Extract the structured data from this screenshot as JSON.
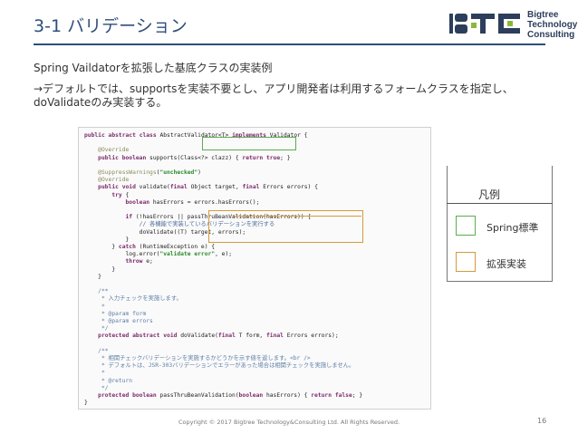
{
  "slide": {
    "title": "3-1 バリデーション",
    "subtitle": "Spring Vaildatorを拡張した基底クラスの実装例",
    "description": "→デフォルトでは、supportsを実装不要とし、アプリ開発者は利用するフォームクラスを指定し、doValidateのみ実装する。"
  },
  "logo": {
    "line1": "Bigtree",
    "line2": "Technology",
    "line3": "Consulting"
  },
  "code": {
    "lines": [
      "public abstract class AbstractValidator<T> implements Validator {",
      "",
      "    @Override",
      "    public boolean supports(Class<?> clazz) { return true; }",
      "",
      "    @SuppressWarnings(\"unchecked\")",
      "    @Override",
      "    public void validate(final Object target, final Errors errors) {",
      "        try {",
      "            boolean hasErrors = errors.hasErrors();",
      "",
      "            if (!hasErrors || passThruBeanValidation(hasErrors)) {",
      "                // 各機能で実装しているバリデーションを実行する",
      "                doValidate((T) target, errors);",
      "            }",
      "        } catch (RuntimeException e) {",
      "            log.error(\"validate error\", e);",
      "            throw e;",
      "        }",
      "    }",
      "",
      "    /**",
      "     * 入力チェックを実施します。",
      "     *",
      "     * @param form",
      "     * @param errors",
      "     */",
      "    protected abstract void doValidate(final T form, final Errors errors);",
      "",
      "    /**",
      "     * 相関チェックバリデーションを実施するかどうかを示す値を返します。<br />",
      "     * デフォルトは、JSR-303バリデーションでエラーがあった場合は相関チェックを実施しません。",
      "     *",
      "     * @return",
      "     */",
      "    protected boolean passThruBeanValidation(boolean hasErrors) { return false; }",
      "}"
    ]
  },
  "legend": {
    "title": "凡例",
    "items": [
      {
        "label": "Spring標準",
        "color": "#5cad50"
      },
      {
        "label": "拡張実装",
        "color": "#d49a3a"
      }
    ]
  },
  "footer": {
    "copyright": "Copyright © 2017 Bigtree Technology&Consulting Ltd. All Rights Reserved.",
    "page": "16"
  },
  "colors": {
    "title": "#2e4f7a",
    "green_box": "#5cad50",
    "orange_box": "#d49a3a"
  }
}
